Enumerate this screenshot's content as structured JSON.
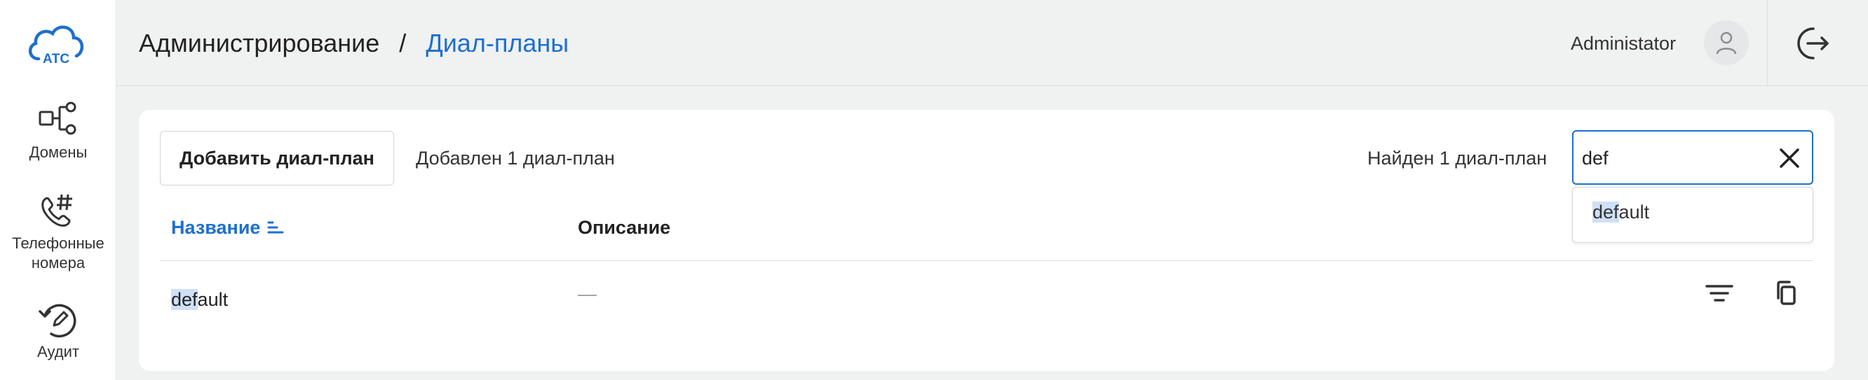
{
  "app": {
    "logo_text": "АТС",
    "brand_color": "#1e6fd0"
  },
  "sidebar": {
    "items": [
      {
        "label": "Домены",
        "icon": "domains-icon"
      },
      {
        "label": "Телефонные номера",
        "icon": "phone-numbers-icon"
      },
      {
        "label": "Аудит",
        "icon": "audit-icon"
      }
    ]
  },
  "header": {
    "breadcrumb_root": "Администрирование",
    "breadcrumb_separator": "/",
    "breadcrumb_current": "Диал-планы",
    "user_name": "Administator",
    "avatar_icon": "user-icon",
    "logout_icon": "logout-icon"
  },
  "toolbar": {
    "add_button_label": "Добавить диал-план",
    "added_info": "Добавлен 1 диал-план",
    "found_info": "Найден 1 диал-план"
  },
  "search": {
    "value": "def",
    "clear_icon": "close-icon",
    "suggestions": [
      {
        "match": "def",
        "rest": "ault"
      }
    ]
  },
  "table": {
    "columns": {
      "name": "Название",
      "description": "Описание"
    },
    "sort_icon": "sort-ascending-icon",
    "rows": [
      {
        "name_match": "def",
        "name_rest": "ault",
        "description": "—",
        "actions": [
          "filter-icon",
          "copy-icon"
        ]
      }
    ]
  }
}
